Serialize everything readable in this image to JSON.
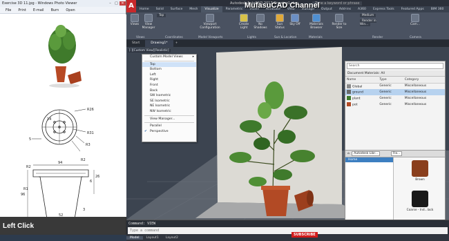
{
  "viewer": {
    "title": "Exercise 3D 11.jpg - Windows Photo Viewer",
    "menu": [
      "File",
      "Print",
      "E-mail",
      "Burn",
      "Open"
    ],
    "dims": {
      "top": [
        "R26",
        "14",
        "R31",
        "R3",
        "R2"
      ],
      "left_small": "5",
      "front_top": "94",
      "front_left": [
        "R2",
        "R1",
        "96"
      ],
      "front_right": [
        "26",
        "6",
        "3"
      ],
      "front_bottom": "52"
    },
    "overlay_label": "Left Click"
  },
  "acad": {
    "title": "Autodesk AutoCAD 2017    Drawing1.dwg",
    "search_placeholder": "Type a keyword or phrase",
    "logo": "A",
    "ribbon_tabs": [
      "Home",
      "Solid",
      "Surface",
      "Mesh",
      "Visualize",
      "Parametric",
      "Insert",
      "Annotate",
      "View",
      "Manage",
      "Output",
      "Add-ins",
      "A360",
      "Express Tools",
      "Featured Apps",
      "BIM 360"
    ],
    "active_ribbon_tab": "Visualize",
    "ribbon_buttons": [
      {
        "label": "Views"
      },
      {
        "label": "View Manager"
      },
      {
        "label": "Top"
      },
      {
        "label": "Viewport Configuration"
      },
      {
        "label": "Create Light"
      },
      {
        "label": "No Shadows"
      },
      {
        "label": "Sun Status"
      },
      {
        "label": "Sky Off"
      },
      {
        "label": "Materials Browser"
      },
      {
        "label": "Render to Size"
      },
      {
        "label": "Medium"
      },
      {
        "label": "Render in Win..."
      },
      {
        "label": "Cam..."
      }
    ],
    "panel_labels": [
      "Views",
      "Coordinates",
      "Model Viewports",
      "Lights",
      "Sun & Location",
      "Materials",
      "Render",
      "Camera"
    ],
    "file_tabs": [
      "Start",
      "Drawing1*"
    ],
    "active_file_tab": "Drawing1*",
    "viewport_controls": "[-][Custom View][Realistic]",
    "context_menu": {
      "header": "Custom Model Views",
      "items": [
        "Top",
        "Bottom",
        "Left",
        "Right",
        "Front",
        "Back",
        "SW Isometric",
        "SE Isometric",
        "NE Isometric",
        "NW Isometric"
      ],
      "highlighted": "Top",
      "view_manager": "View Manager...",
      "parallel": "Parallel",
      "perspective": "Perspective",
      "checked": "Perspective"
    },
    "materials_palette": {
      "search_placeholder": "Search",
      "header": "Document Materials: All",
      "columns": [
        "Name",
        "Type",
        "Category"
      ],
      "rows": [
        {
          "name": "Global",
          "type": "Generic",
          "category": "Miscellaneous",
          "color": "#8a8a8a"
        },
        {
          "name": "ground",
          "type": "Generic",
          "category": "Miscellaneous",
          "color": "#6a6a6a"
        },
        {
          "name": "plant",
          "type": "Generic",
          "category": "Miscellaneous",
          "color": "#3e7a2c"
        },
        {
          "name": "pot",
          "type": "Generic",
          "category": "Miscellaneous",
          "color": "#b24a25"
        }
      ],
      "selected_row": "ground",
      "library_bar": "Autodesk Libr...",
      "library_bar2": "Fla...",
      "tree_home": "Home",
      "thumbnails": [
        {
          "label": "Brown",
          "color": "#8a3f1d"
        },
        {
          "label": "Coarse - Ind...lack",
          "color": "#1a1a1a"
        }
      ]
    },
    "command_history": "Command: VIEW",
    "command_placeholder": "Type a command",
    "layout_tabs": [
      "Model",
      "Layout1",
      "Layout2"
    ],
    "active_layout_tab": "Model"
  },
  "watermark": {
    "channel": "MufasuCAD Channel",
    "subscribe": "SUBSCRIBE"
  }
}
